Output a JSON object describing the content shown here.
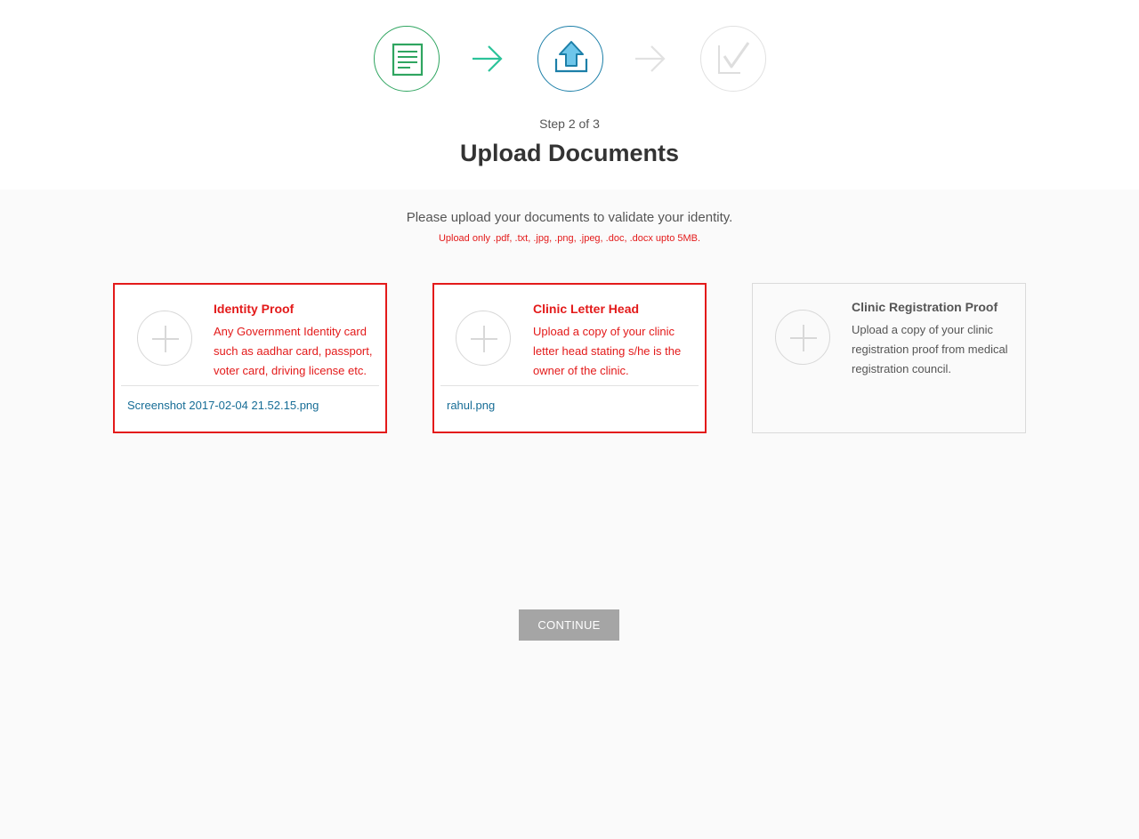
{
  "stepper": {
    "step_label": "Step 2 of 3",
    "title": "Upload Documents",
    "steps": [
      {
        "icon": "document-icon",
        "state": "completed",
        "color": "#2fa560"
      },
      {
        "icon": "upload-icon",
        "state": "active",
        "color": "#1c7fa8"
      },
      {
        "icon": "checkmark-icon",
        "state": "pending",
        "color": "#e1e1e1"
      }
    ]
  },
  "intro": {
    "text": "Please upload your documents to validate your identity.",
    "warning": "Upload only .pdf, .txt, .jpg, .png, .jpeg, .doc, .docx upto 5MB."
  },
  "cards": [
    {
      "title": "Identity Proof",
      "description": "Any Government Identity card such as aadhar card, passport, voter card, driving license etc.",
      "file": "Screenshot 2017-02-04 21.52.15.png",
      "state": "error"
    },
    {
      "title": "Clinic Letter Head",
      "description": "Upload a copy of your clinic letter head stating s/he is the owner of the clinic.",
      "file": "rahul.png",
      "state": "error"
    },
    {
      "title": "Clinic Registration Proof",
      "description": "Upload a copy of your clinic registration proof from medical registration council.",
      "file": "",
      "state": "normal"
    }
  ],
  "continue_label": "CONTINUE",
  "colors": {
    "error": "#e31a1a",
    "success": "#2fa560",
    "active": "#1c7fa8",
    "link": "#176d96",
    "button": "#a5a5a5"
  }
}
